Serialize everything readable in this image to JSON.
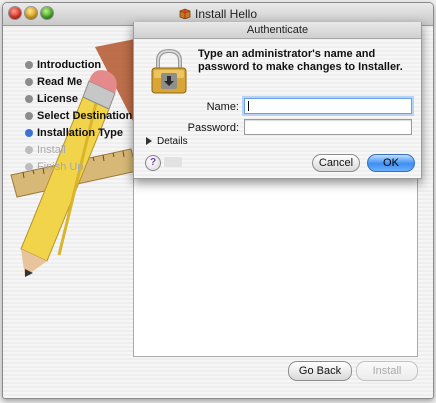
{
  "window": {
    "title": "Install Hello"
  },
  "steps": [
    {
      "label": "Introduction",
      "state": "done"
    },
    {
      "label": "Read Me",
      "state": "done"
    },
    {
      "label": "License",
      "state": "done"
    },
    {
      "label": "Select Destination",
      "state": "done"
    },
    {
      "label": "Installation Type",
      "state": "active"
    },
    {
      "label": "Install",
      "state": "pending"
    },
    {
      "label": "Finish Up",
      "state": "pending"
    }
  ],
  "buttons": {
    "go_back": "Go Back",
    "install": "Install"
  },
  "auth": {
    "title": "Authenticate",
    "prompt": "Type an administrator's name and password to make changes to Installer.",
    "name_label": "Name:",
    "name_value": "",
    "password_label": "Password:",
    "password_value": "",
    "details_label": "Details",
    "help_symbol": "?",
    "cancel_label": "Cancel",
    "ok_label": "OK"
  },
  "icons": [
    "close-icon",
    "minimize-icon",
    "zoom-icon",
    "package-icon",
    "lock-icon",
    "help-icon",
    "disclosure-triangle-icon"
  ],
  "colors": {
    "accent": "#3d8ef3",
    "active_step": "#3b73d4"
  }
}
